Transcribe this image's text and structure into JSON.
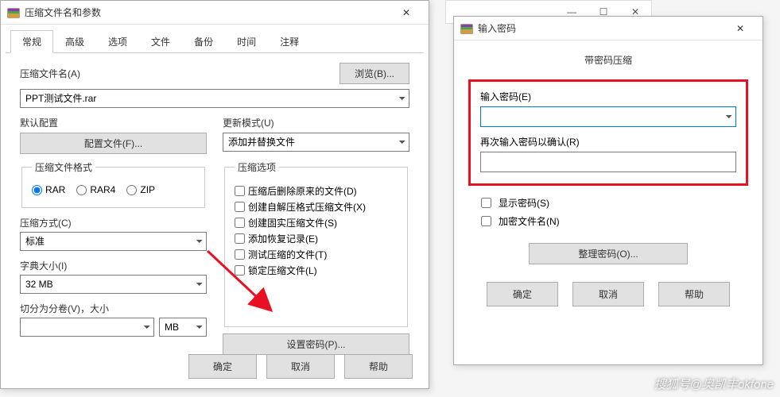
{
  "bgwin": {
    "min": "—",
    "max": "☐",
    "close": "✕"
  },
  "dlg1": {
    "title": "压缩文件名和参数",
    "close_icon": "✕",
    "tabs": [
      "常规",
      "高级",
      "选项",
      "文件",
      "备份",
      "时间",
      "注释"
    ],
    "filename_label": "压缩文件名(A)",
    "browse_btn": "浏览(B)...",
    "filename_value": "PPT测试文件.rar",
    "default_cfg_label": "默认配置",
    "cfg_btn": "配置文件(F)...",
    "update_mode_label": "更新模式(U)",
    "update_mode_value": "添加并替换文件",
    "format_group": "压缩文件格式",
    "fmt_rar": "RAR",
    "fmt_rar4": "RAR4",
    "fmt_zip": "ZIP",
    "method_label": "压缩方式(C)",
    "method_value": "标准",
    "dict_label": "字典大小(I)",
    "dict_value": "32 MB",
    "split_label": "切分为分卷(V)，大小",
    "split_unit": "MB",
    "opts_group": "压缩选项",
    "opt1": "压缩后删除原来的文件(D)",
    "opt2": "创建自解压格式压缩文件(X)",
    "opt3": "创建固实压缩文件(S)",
    "opt4": "添加恢复记录(E)",
    "opt5": "测试压缩的文件(T)",
    "opt6": "锁定压缩文件(L)",
    "setpwd_btn": "设置密码(P)...",
    "ok": "确定",
    "cancel": "取消",
    "help": "帮助"
  },
  "dlg2": {
    "title": "输入密码",
    "close_icon": "✕",
    "subtitle": "带密码压缩",
    "pwd_label": "输入密码(E)",
    "confirm_label": "再次输入密码以确认(R)",
    "show_pwd": "显示密码(S)",
    "enc_name": "加密文件名(N)",
    "organize": "整理密码(O)...",
    "ok": "确定",
    "cancel": "取消",
    "help": "帮助"
  },
  "watermark": "搜狐号@奥凯丰okfone"
}
